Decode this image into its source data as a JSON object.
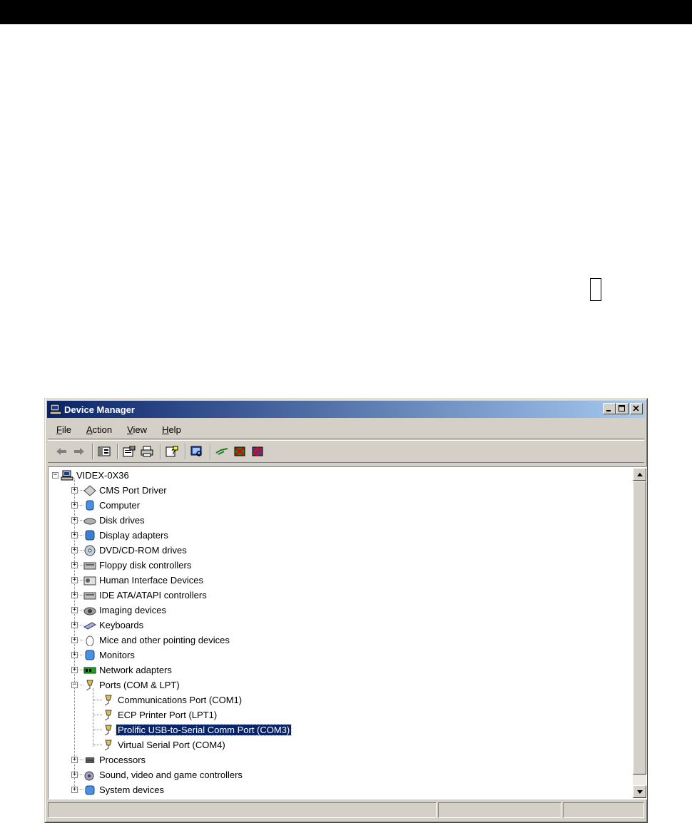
{
  "window": {
    "title": "Device Manager",
    "controls": {
      "minimize": "_",
      "maximize": "□",
      "close": "×"
    }
  },
  "menu": [
    {
      "label_u": "F",
      "label_rest": "ile"
    },
    {
      "label_u": "A",
      "label_rest": "ction"
    },
    {
      "label_u": "V",
      "label_rest": "iew"
    },
    {
      "label_u": "H",
      "label_rest": "elp"
    }
  ],
  "toolbar": {
    "buttons": [
      "back-icon",
      "forward-icon",
      "show-hide-tree-icon",
      "properties-icon",
      "print-icon",
      "help-icon",
      "scan-hardware-icon",
      "update-driver-icon",
      "disable-icon",
      "uninstall-icon"
    ]
  },
  "tree": {
    "root": "VIDEX-0X36",
    "categories": [
      "CMS Port Driver",
      "Computer",
      "Disk drives",
      "Display adapters",
      "DVD/CD-ROM drives",
      "Floppy disk controllers",
      "Human Interface Devices",
      "IDE ATA/ATAPI controllers",
      "Imaging devices",
      "Keyboards",
      "Mice and other pointing devices",
      "Monitors",
      "Network adapters",
      "Ports (COM & LPT)",
      "Processors",
      "Sound, video and game controllers",
      "System devices"
    ],
    "ports_children": [
      "Communications Port (COM1)",
      "ECP Printer Port (LPT1)",
      "Prolific USB-to-Serial Comm Port (COM3)",
      "Virtual Serial Port (COM4)"
    ],
    "selected": "Prolific USB-to-Serial Comm Port (COM3)"
  },
  "colors": {
    "title_gradient_start": "#0a246a",
    "title_gradient_end": "#a6caf0",
    "selection": "#0a246a",
    "face": "#d4d0c8"
  }
}
